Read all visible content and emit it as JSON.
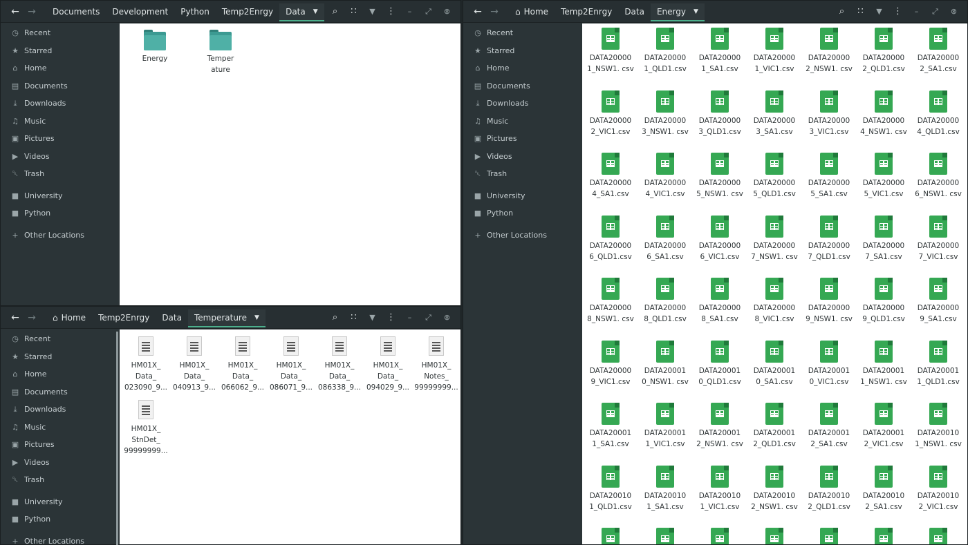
{
  "windows": {
    "data": {
      "breadcrumbs": [
        "Documents",
        "Development",
        "Python",
        "Temp2Enrgy"
      ],
      "current": "Data",
      "items": [
        "Energy",
        "Temperature"
      ]
    },
    "temperature": {
      "breadcrumbs": [
        "Home",
        "Temp2Enrgy",
        "Data"
      ],
      "current": "Temperature",
      "items": [
        "HM01X_ Data_ 023090_9...",
        "HM01X_ Data_ 040913_9...",
        "HM01X_ Data_ 066062_9...",
        "HM01X_ Data_ 086071_9...",
        "HM01X_ Data_ 086338_9...",
        "HM01X_ Data_ 094029_9...",
        "HM01X_ Notes_ 99999999...",
        "HM01X_ StnDet_ 99999999..."
      ]
    },
    "energy": {
      "breadcrumbs": [
        "Home",
        "Temp2Enrgy",
        "Data"
      ],
      "current": "Energy",
      "items": [
        "DATA20000 1_NSW1. csv",
        "DATA20000 1_QLD1.csv",
        "DATA20000 1_SA1.csv",
        "DATA20000 1_VIC1.csv",
        "DATA20000 2_NSW1. csv",
        "DATA20000 2_QLD1.csv",
        "DATA20000 2_SA1.csv",
        "DATA20000 2_VIC1.csv",
        "DATA20000 3_NSW1. csv",
        "DATA20000 3_QLD1.csv",
        "DATA20000 3_SA1.csv",
        "DATA20000 3_VIC1.csv",
        "DATA20000 4_NSW1. csv",
        "DATA20000 4_QLD1.csv",
        "DATA20000 4_SA1.csv",
        "DATA20000 4_VIC1.csv",
        "DATA20000 5_NSW1. csv",
        "DATA20000 5_QLD1.csv",
        "DATA20000 5_SA1.csv",
        "DATA20000 5_VIC1.csv",
        "DATA20000 6_NSW1. csv",
        "DATA20000 6_QLD1.csv",
        "DATA20000 6_SA1.csv",
        "DATA20000 6_VIC1.csv",
        "DATA20000 7_NSW1. csv",
        "DATA20000 7_QLD1.csv",
        "DATA20000 7_SA1.csv",
        "DATA20000 7_VIC1.csv",
        "DATA20000 8_NSW1. csv",
        "DATA20000 8_QLD1.csv",
        "DATA20000 8_SA1.csv",
        "DATA20000 8_VIC1.csv",
        "DATA20000 9_NSW1. csv",
        "DATA20000 9_QLD1.csv",
        "DATA20000 9_SA1.csv",
        "DATA20000 9_VIC1.csv",
        "DATA20001 0_NSW1. csv",
        "DATA20001 0_QLD1.csv",
        "DATA20001 0_SA1.csv",
        "DATA20001 0_VIC1.csv",
        "DATA20001 1_NSW1. csv",
        "DATA20001 1_QLD1.csv",
        "DATA20001 1_SA1.csv",
        "DATA20001 1_VIC1.csv",
        "DATA20001 2_NSW1. csv",
        "DATA20001 2_QLD1.csv",
        "DATA20001 2_SA1.csv",
        "DATA20001 2_VIC1.csv",
        "DATA20010 1_NSW1. csv",
        "DATA20010 1_QLD1.csv",
        "DATA20010 1_SA1.csv",
        "DATA20010 1_VIC1.csv",
        "DATA20010 2_NSW1. csv",
        "DATA20010 2_QLD1.csv",
        "DATA20010 2_SA1.csv",
        "DATA20010 2_VIC1.csv",
        "",
        "",
        "",
        "",
        "",
        "",
        ""
      ]
    }
  },
  "sidebar": {
    "places": [
      {
        "label": "Recent",
        "icon": "clock-icon"
      },
      {
        "label": "Starred",
        "icon": "star-icon"
      },
      {
        "label": "Home",
        "icon": "home-icon"
      },
      {
        "label": "Documents",
        "icon": "document-icon"
      },
      {
        "label": "Downloads",
        "icon": "download-icon"
      },
      {
        "label": "Music",
        "icon": "music-icon"
      },
      {
        "label": "Pictures",
        "icon": "picture-icon"
      },
      {
        "label": "Videos",
        "icon": "video-icon"
      },
      {
        "label": "Trash",
        "icon": "trash-icon"
      }
    ],
    "bookmarks": [
      {
        "label": "University",
        "icon": "folder-icon"
      },
      {
        "label": "Python",
        "icon": "folder-icon"
      }
    ],
    "other": {
      "label": "Other Locations",
      "icon": "plus-icon"
    }
  },
  "colors": {
    "accent": "#4caf8c",
    "folder": "#3c9a92",
    "csv": "#35a853"
  }
}
